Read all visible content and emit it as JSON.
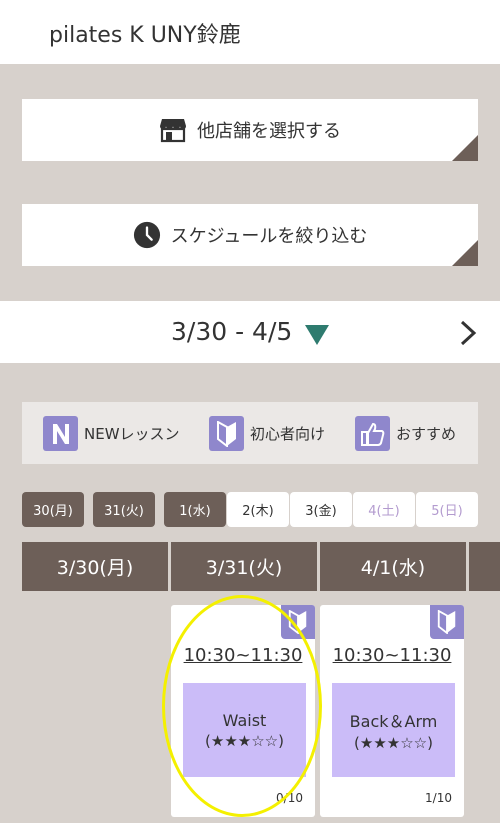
{
  "header": {
    "title": "pilates K UNY鈴鹿"
  },
  "actions": {
    "other_store": "他店舗を選択する",
    "filter_schedule": "スケジュールを絞り込む"
  },
  "date_bar": {
    "range": "3/30 - 4/5"
  },
  "legend": {
    "new": "NEWレッスン",
    "beginner": "初心者向け",
    "recommend": "おすすめ"
  },
  "days": [
    {
      "label": "30(月)"
    },
    {
      "label": "31(火)"
    },
    {
      "label": "1(水)"
    },
    {
      "label": "2(木)"
    },
    {
      "label": "3(金)"
    },
    {
      "label": "4(土)"
    },
    {
      "label": "5(日)"
    }
  ],
  "columns": [
    "3/30(月)",
    "3/31(火)",
    "4/1(水)"
  ],
  "lessons": [
    {
      "time": "10:30~11:30",
      "name": "Waist",
      "stars": "(★★★☆☆)",
      "count": "0/10"
    },
    {
      "time": "10:30~11:30",
      "name": "Back＆Arm",
      "stars": "(★★★☆☆)",
      "count": "1/10"
    }
  ],
  "colors": {
    "background": "#d7d1cc",
    "dark_brown": "#6d5f58",
    "purple_badge": "#8f87cc",
    "lesson_fill": "#cbbcf8",
    "highlight": "#f4f000"
  }
}
